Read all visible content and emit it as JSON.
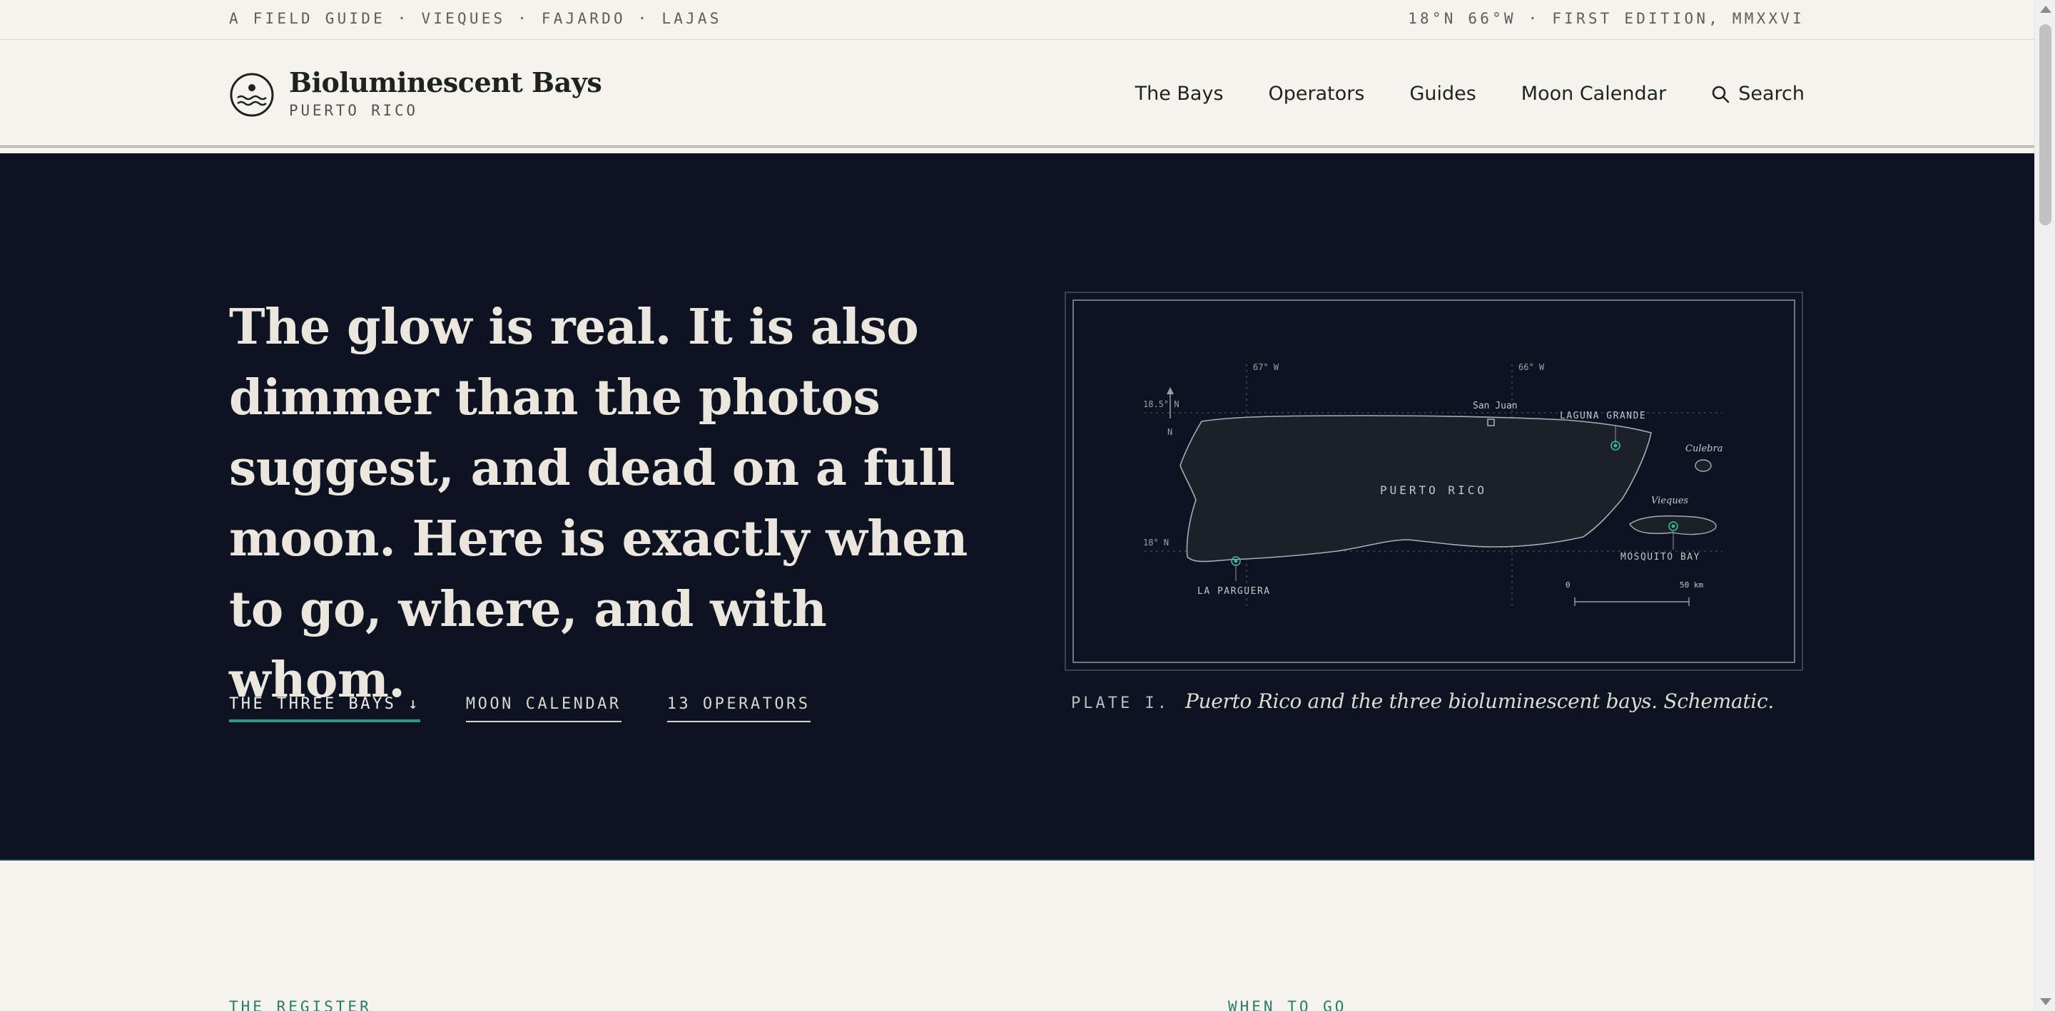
{
  "topstrip": {
    "left": "A FIELD GUIDE · VIEQUES · FAJARDO · LAJAS",
    "right": "18°N 66°W · FIRST EDITION, MMXXVI"
  },
  "header": {
    "title": "Bioluminescent Bays",
    "subtitle": "PUERTO RICO",
    "nav": [
      {
        "label": "The Bays"
      },
      {
        "label": "Operators"
      },
      {
        "label": "Guides"
      },
      {
        "label": "Moon Calendar"
      }
    ],
    "search_label": "Search",
    "search_icon": "search-icon"
  },
  "hero": {
    "headline": "The glow is real. It is also dimmer than the photos suggest, and dead on a full moon. Here is exactly when to go, where, and with whom.",
    "links": [
      {
        "label": "THE THREE BAYS ↓"
      },
      {
        "label": "MOON CALENDAR"
      },
      {
        "label": "13 OPERATORS"
      }
    ],
    "accent_color": "#2b9a82"
  },
  "map": {
    "lon_labels": [
      "67° W",
      "66° W"
    ],
    "lat_labels": [
      "18.5° N",
      "18° N"
    ],
    "north_label": "N",
    "island_label": "PUERTO RICO",
    "places": {
      "san_juan": "San Juan",
      "laguna_grande": "LAGUNA GRANDE",
      "culebra": "Culebra",
      "vieques": "Vieques",
      "mosquito_bay": "MOSQUITO BAY",
      "la_parguera": "LA PARGUERA"
    },
    "scale": {
      "start": "0",
      "end": "50 km"
    }
  },
  "caption": {
    "label": "PLATE I.",
    "text": "Puerto Rico and the three bioluminescent bays. Schematic."
  },
  "sections": {
    "register": "THE REGISTER",
    "when": "WHEN TO GO"
  }
}
